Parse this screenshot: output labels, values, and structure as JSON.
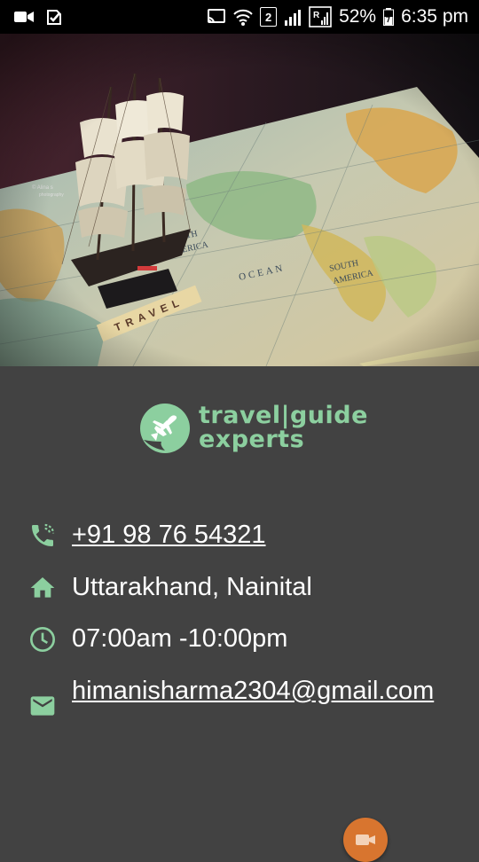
{
  "status_bar": {
    "battery_percent": "52%",
    "time": "6:35 pm",
    "sim_label": "2",
    "left_icons": [
      "video-call-icon",
      "notification-check-icon"
    ],
    "right_icons": [
      "cast-icon",
      "wifi-icon",
      "sim-2-icon",
      "signal-icon",
      "roaming-signal-icon",
      "battery-icon"
    ]
  },
  "hero": {
    "alt_subject": "ship-on-world-map-photo",
    "watermark": "© Alina s photography",
    "map_labels": [
      "NORTH AMERICA",
      "OCEAN",
      "SOUTH AMERICA",
      "TRAVEL"
    ]
  },
  "brand": {
    "line1": "travel|guide",
    "line2": "experts",
    "color": "#8ccf9f"
  },
  "contact": {
    "phone": "+91 98 76 54321",
    "address": "Uttarakhand, Nainital",
    "hours": "07:00am -10:00pm",
    "email": "himanisharma2304@gmail.com",
    "icon_color": "#8ccf9f"
  },
  "fab": {
    "icon": "video-camera-icon",
    "color": "#d8752f"
  }
}
